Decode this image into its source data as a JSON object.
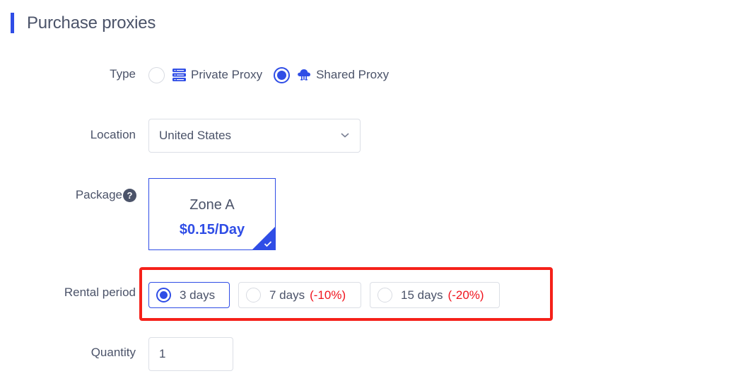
{
  "page": {
    "title": "Purchase proxies",
    "accent_color": "#2f4de6",
    "highlight_color": "#f5211a",
    "discount_color": "#f0141e"
  },
  "form": {
    "type": {
      "label": "Type",
      "options": [
        {
          "label": "Private Proxy",
          "icon": "server-icon",
          "selected": false
        },
        {
          "label": "Shared Proxy",
          "icon": "cloud-icon",
          "selected": true
        }
      ]
    },
    "location": {
      "label": "Location",
      "value": "United States"
    },
    "package": {
      "label": "Package",
      "help_icon": "?",
      "cards": [
        {
          "name": "Zone A",
          "price": "$0.15/Day",
          "selected": true
        }
      ]
    },
    "rental_period": {
      "label": "Rental period",
      "options": [
        {
          "label": "3 days",
          "discount": "",
          "selected": true
        },
        {
          "label": "7 days",
          "discount": "(-10%)",
          "selected": false
        },
        {
          "label": "15 days",
          "discount": "(-20%)",
          "selected": false
        }
      ]
    },
    "quantity": {
      "label": "Quantity",
      "value": "1"
    }
  }
}
